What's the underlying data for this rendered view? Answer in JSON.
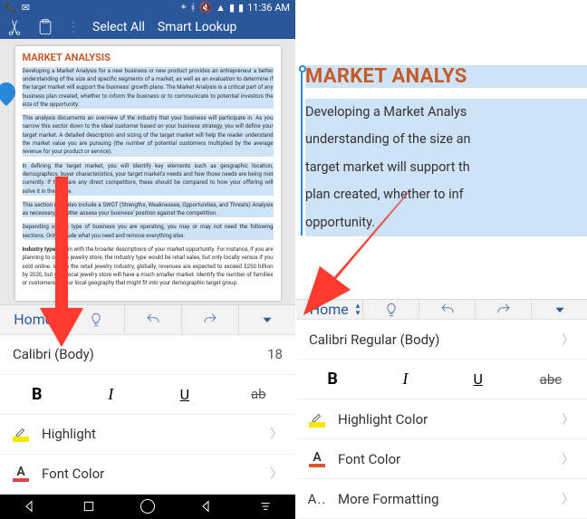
{
  "status": {
    "time": "11:36 AM"
  },
  "topbar": {
    "selectAll": "Select All",
    "smartLookup": "Smart Lookup"
  },
  "doc": {
    "heading": "MARKET ANALYSIS",
    "headingR": "MARKET ANALYS",
    "p1": "Developing a Market Analysis for a new business or new product provides an entrepreneur a better understanding of the size and specific segments of a market, as well as an evaluation to determine if the target market will support the business' growth plans. The Market Analysis is a critical part of any business plan created, whether to inform the business or to communicate to potential investors the size of the opportunity.",
    "p2": "This analysis documents an overview of the industry that your business will participate in. As you narrow this sector down to the ideal customer based on your business strategy, you will define your target market. A detailed description and sizing of the target market will help the reader understand the market value you are pursuing (the number of potential customers multiplied by the average revenue for your product or service).",
    "p3": "In defining the target market, you will identify key elements such as geographic location, demographics, buyer characteristics, your target market's needs and how those needs are being met currently. If there are any direct competitors, these should be compared to how your offering will solve it in the future.",
    "p4": "This section may also include a SWOT (Strengths, Weaknesses, Opportunities, and Threats) Analysis as necessary, to better assess your business' position against the competition.",
    "p5": "Depending on the type of business you are operating, you may or may not need the following sections. Only include what you need and remove everything else.",
    "p6head": "Industry type:",
    "p6": " Begin with the broader descriptions of your market opportunity. For instance, if you are planning to open a jewelry store, the industry type would be retail sales, but only locally versus if you sold online. Within the retail jewelry industry, globally, revenues are expected to exceed $250 billion by 2020, but your local jewelry store will have a much smaller market. Identify the number of families or customers in your local geography that might fit into your demographic target group.",
    "rp1": "Developing a Market Analys",
    "rp2": "understanding of the size an",
    "rp3": "target market will support th",
    "rp4": "plan created, whether to inf",
    "rp5": "opportunity."
  },
  "ribbon": {
    "home": "Home"
  },
  "rows": {
    "fontL": "Calibri (Body)",
    "sizeL": "18",
    "fontR": "Calibri Regular (Body)",
    "bold": "B",
    "italic": "I",
    "underline": "U",
    "strikeL": "ab",
    "strikeR": "abc",
    "highlightL": "Highlight",
    "highlightR": "Highlight Color",
    "fontColor": "Font Color",
    "moreFmt": "More Formatting"
  }
}
